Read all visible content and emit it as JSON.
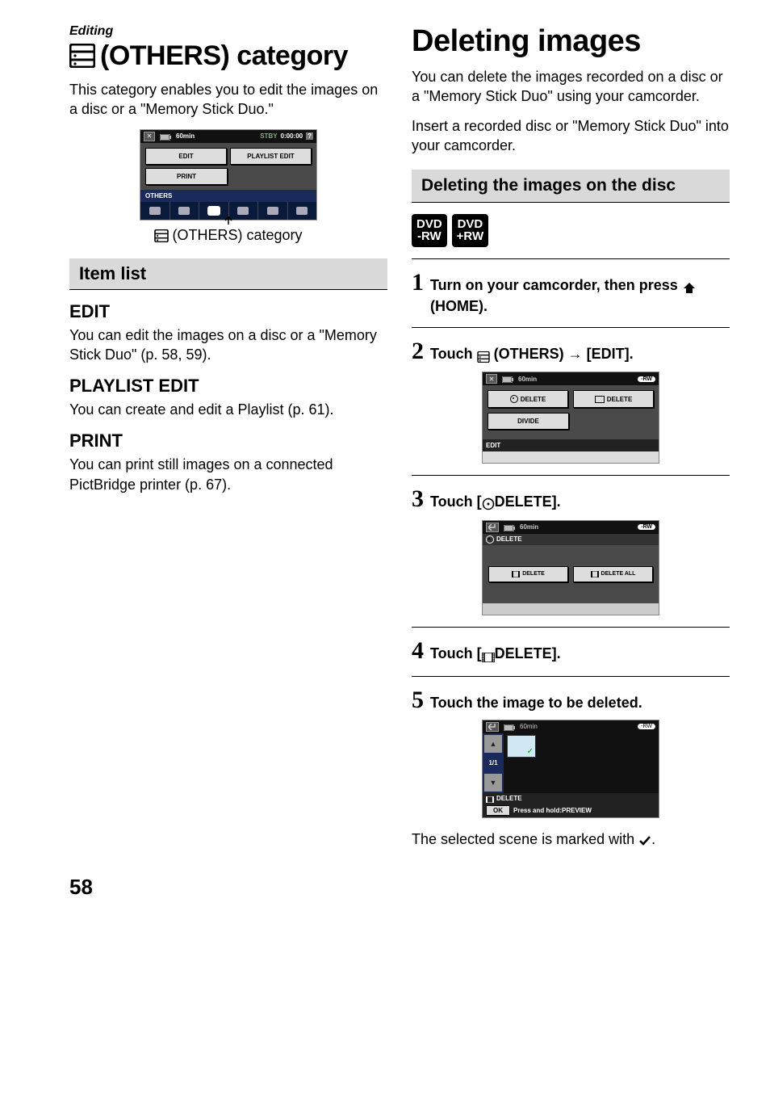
{
  "left": {
    "breadcrumb": "Editing",
    "title": "(OTHERS) category",
    "intro": "This category enables you to edit the images on a disc or a \"Memory Stick Duo.\"",
    "shot1": {
      "battery": "60min",
      "status": "STBY",
      "time": "0:00:00",
      "help": "?",
      "btn_edit": "EDIT",
      "btn_playlist": "PLAYLIST EDIT",
      "btn_print": "PRINT",
      "bar": "OTHERS"
    },
    "caption": "(OTHERS) category",
    "itemlist_heading": "Item list",
    "edit_h": "EDIT",
    "edit_p": "You can edit the images on a disc or a \"Memory Stick Duo\" (p. 58, 59).",
    "pl_h": "PLAYLIST EDIT",
    "pl_p": "You can create and edit a Playlist (p. 61).",
    "pr_h": "PRINT",
    "pr_p": "You can print still images on a connected PictBridge printer (p. 67)."
  },
  "right": {
    "title": "Deleting images",
    "intro1": "You can delete the images recorded on a disc or a \"Memory Stick Duo\" using your camcorder.",
    "intro2": "Insert a recorded disc or \"Memory Stick Duo\" into your camcorder.",
    "sub_heading": "Deleting the images on the disc",
    "badge1a": "DVD",
    "badge1b": "-RW",
    "badge2a": "DVD",
    "badge2b": "+RW",
    "step1": "Turn on your camcorder, then press ",
    "step1b": "(HOME).",
    "step2a": "Touch ",
    "step2b": "(OTHERS) → [EDIT].",
    "shot2": {
      "battery": "60min",
      "rw": "-RW",
      "btn_delete_disc": "DELETE",
      "btn_delete_ms": "DELETE",
      "btn_divide": "DIVIDE",
      "label": "EDIT"
    },
    "step3a": "Touch [",
    "step3b": "DELETE].",
    "shot3": {
      "battery": "60min",
      "rw": "-RW",
      "header": "DELETE",
      "btn_delete": "DELETE",
      "btn_delete_all": "DELETE ALL"
    },
    "step4a": "Touch [",
    "step4b": "DELETE].",
    "step5": "Touch the image to be deleted.",
    "shot4": {
      "battery": "60min",
      "rw": "-RW",
      "page": "1/1",
      "label": "DELETE",
      "ok": "OK",
      "hint": "Press and hold:PREVIEW"
    },
    "closing": "The selected scene is marked with "
  },
  "page_number": "58"
}
